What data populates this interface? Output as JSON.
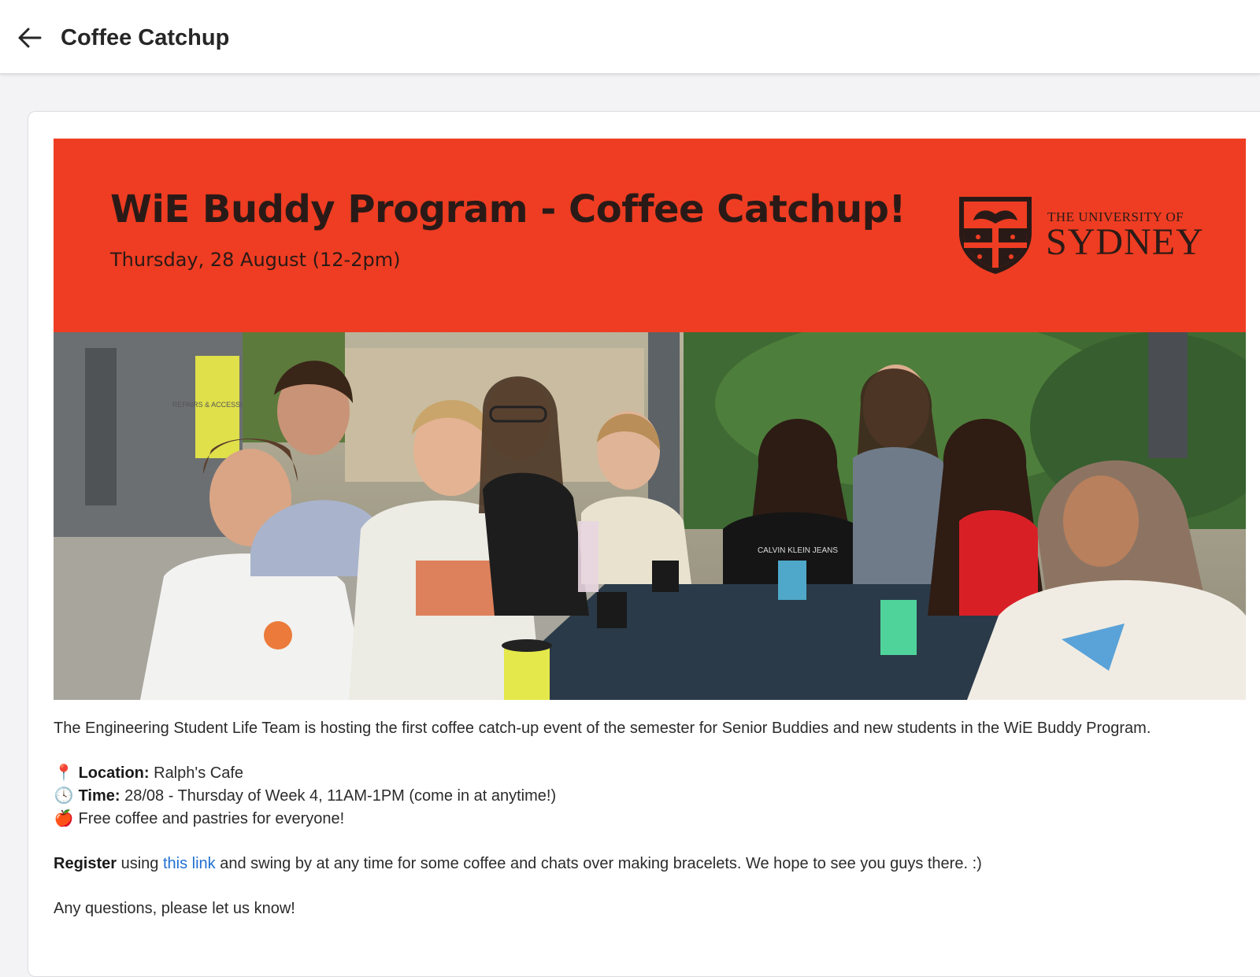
{
  "header": {
    "title": "Coffee Catchup",
    "back_icon": "arrow-left-icon"
  },
  "banner": {
    "title": "WiE Buddy Program - Coffee Catchup!",
    "date": "Thursday, 28 August (12-2pm)",
    "logo_line1": "THE UNIVERSITY OF",
    "logo_line2": "SYDNEY",
    "background_color": "#ee3d22"
  },
  "photo": {
    "shirt_text": "CALVIN KLEIN JEANS",
    "sign_text": "REPAIRS & ACCESSORIES"
  },
  "description": {
    "intro": "The Engineering Student Life Team is hosting the first coffee catch-up event of the semester for Senior Buddies and new students in the WiE Buddy Program.",
    "location_icon": "📍",
    "location_label": "Location:",
    "location_value": " Ralph's Cafe",
    "time_icon": "🕓",
    "time_label": "Time:",
    "time_value": " 28/08 - Thursday of Week 4, 11AM-1PM (come in at anytime!)",
    "food_icon": "🍎",
    "food_text": " Free coffee and pastries for everyone!",
    "register_bold": "Register",
    "register_pre": " using ",
    "register_link": "this link",
    "register_post": " and swing by at any time for some coffee and chats over making bracelets. We hope to see you guys there. :)",
    "closing": "Any questions, please let us know!"
  }
}
